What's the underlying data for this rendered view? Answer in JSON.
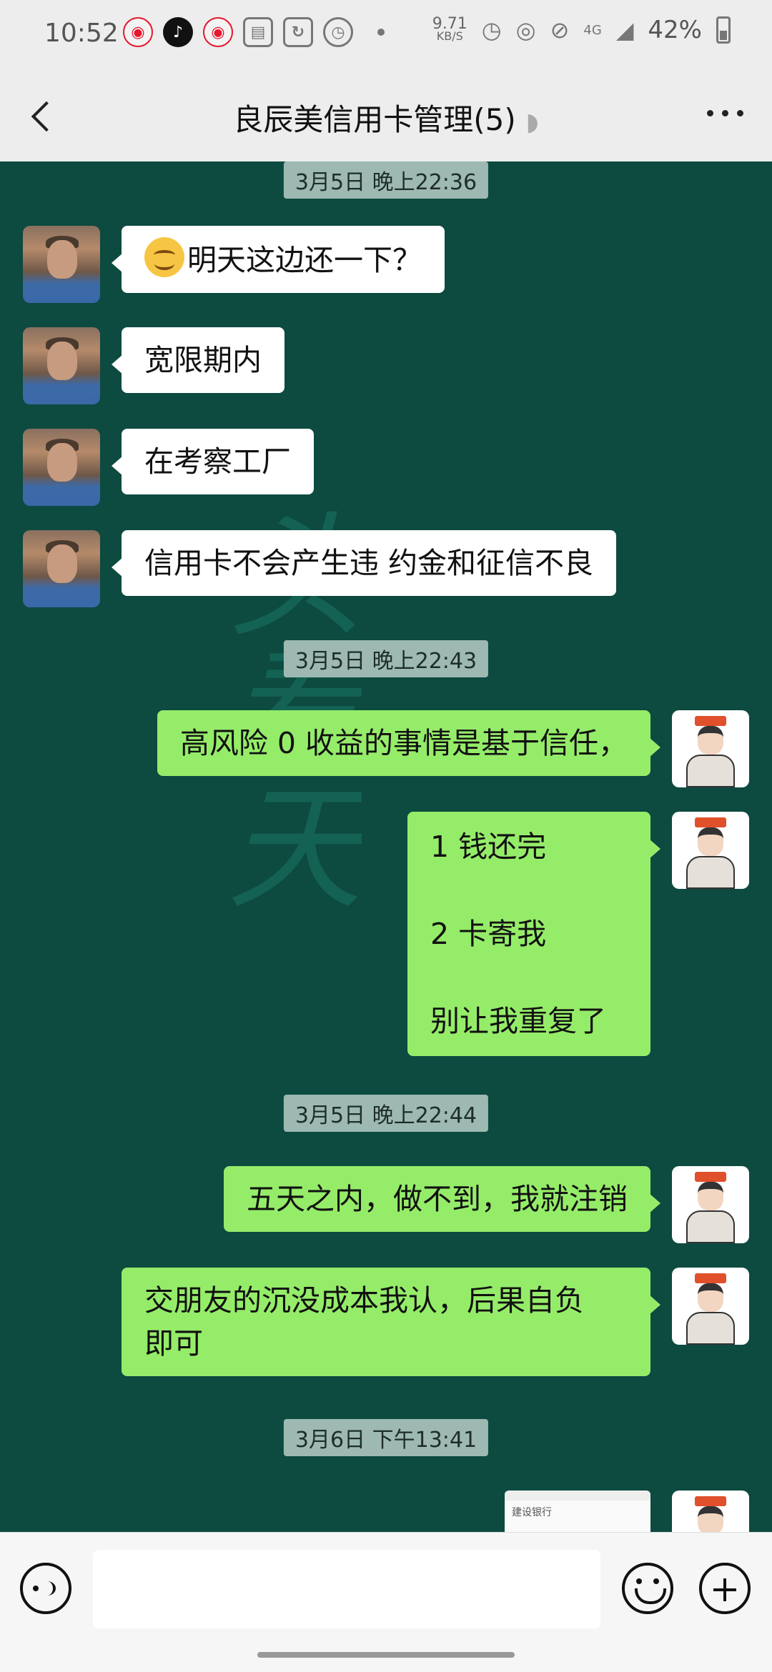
{
  "status_bar": {
    "time": "10:52",
    "net_speed_value": "9.71",
    "net_speed_unit": "KB/S",
    "network": "4G",
    "battery": "42%",
    "icons": [
      "weibo-icon",
      "tiktok-icon",
      "weibo-icon",
      "document-icon",
      "refresh-icon",
      "alarm-icon",
      "dot-icon",
      "alarm-icon",
      "hotspot-icon",
      "mute-icon",
      "signal-icon",
      "battery-icon"
    ]
  },
  "header": {
    "title": "良辰美信用卡管理(5)",
    "ear_icon": "ear-icon",
    "more_icon": "more-icon"
  },
  "chat": {
    "watermark": "头看天",
    "timestamps": [
      "3月5日 晚上22:36",
      "3月5日 晚上22:43",
      "3月5日 晚上22:44",
      "3月6日 下午13:41"
    ],
    "messages": [
      {
        "side": "left",
        "text": "明天这边还一下？",
        "emoji": "smile-emoji"
      },
      {
        "side": "left",
        "text": "宽限期内"
      },
      {
        "side": "left",
        "text": "在考察工厂"
      },
      {
        "side": "left",
        "text": "信用卡不会产生违 约金和征信不良"
      },
      {
        "side": "right",
        "text": "高风险 0 收益的事情是基于信任，"
      },
      {
        "side": "right",
        "lines": [
          "1 钱还完",
          "2 卡寄我",
          "别让我重复了"
        ]
      },
      {
        "side": "right",
        "text": "五天之内，做不到，我就注销"
      },
      {
        "side": "right",
        "lines": [
          "交朋友的沉没成本我认，后果自负",
          "即可"
        ]
      },
      {
        "side": "right",
        "type": "image",
        "caption": "建设银行"
      }
    ]
  },
  "input": {
    "placeholder": "",
    "voice_icon": "voice-icon",
    "emoji_icon": "emoji-icon",
    "plus_icon": "plus-icon"
  },
  "colors": {
    "chat_bg": "#0d4a40",
    "bubble_self": "#95ec69",
    "bubble_other": "#ffffff",
    "header_bg": "#ededed"
  }
}
